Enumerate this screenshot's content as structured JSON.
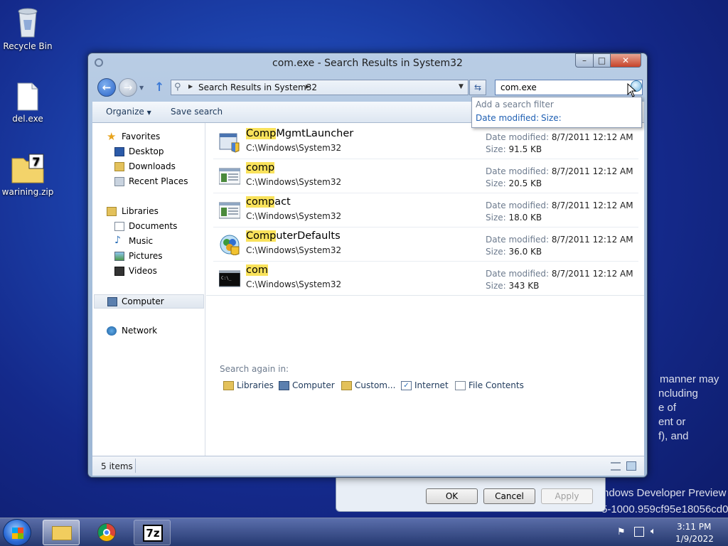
{
  "desktop": {
    "icons": [
      {
        "label": "Recycle Bin"
      },
      {
        "label": "del.exe"
      },
      {
        "label": "warining.zip"
      }
    ],
    "background_text": [
      "manner may",
      "ncluding",
      "e of",
      "ent or",
      "f), and",
      "ndows Developer Preview",
      "5-1000.959cf95e18056cd0"
    ]
  },
  "bg_dialog": {
    "ok_label": "OK",
    "cancel_label": "Cancel",
    "apply_label": "Apply"
  },
  "window": {
    "title": "com.exe - Search Results in System32",
    "address": "Search Results in System32",
    "search_value": "com.exe",
    "toolbar": {
      "organize_label": "Organize",
      "save_search_label": "Save search"
    },
    "filter_dropdown": {
      "heading": "Add a search filter",
      "date_modified": "Date modified:",
      "size": "Size:"
    },
    "nav": {
      "favorites": "Favorites",
      "desktop": "Desktop",
      "downloads": "Downloads",
      "recent": "Recent Places",
      "libraries": "Libraries",
      "documents": "Documents",
      "music": "Music",
      "pictures": "Pictures",
      "videos": "Videos",
      "computer": "Computer",
      "network": "Network"
    },
    "results": [
      {
        "highlight": "Comp",
        "rest": "MgmtLauncher",
        "path": "C:\\Windows\\System32",
        "date_label": "Date modified:",
        "date": "8/7/2011 12:12 AM",
        "size_label": "Size:",
        "size": "91.5 KB",
        "icon": "mmc-launcher-icon"
      },
      {
        "highlight": "comp",
        "rest": "",
        "path": "C:\\Windows\\System32",
        "date_label": "Date modified:",
        "date": "8/7/2011 12:12 AM",
        "size_label": "Size:",
        "size": "20.5 KB",
        "icon": "application-icon"
      },
      {
        "highlight": "comp",
        "rest": "act",
        "path": "C:\\Windows\\System32",
        "date_label": "Date modified:",
        "date": "8/7/2011 12:12 AM",
        "size_label": "Size:",
        "size": "18.0 KB",
        "icon": "application-icon"
      },
      {
        "highlight": "Comp",
        "rest": "uterDefaults",
        "path": "C:\\Windows\\System32",
        "date_label": "Date modified:",
        "date": "8/7/2011 12:12 AM",
        "size_label": "Size:",
        "size": "36.0 KB",
        "icon": "computer-defaults-icon"
      },
      {
        "highlight": "com",
        "rest": "",
        "path": "C:\\Windows\\System32",
        "date_label": "Date modified:",
        "date": "8/7/2011 12:12 AM",
        "size_label": "Size:",
        "size": "343 KB",
        "icon": "console-icon"
      }
    ],
    "search_again": {
      "label": "Search again in:",
      "items": [
        "Libraries",
        "Computer",
        "Custom...",
        "Internet",
        "File Contents"
      ]
    },
    "status": {
      "item_count": "5 items"
    }
  },
  "taskbar": {
    "time": "3:11 PM",
    "date": "1/9/2022"
  }
}
